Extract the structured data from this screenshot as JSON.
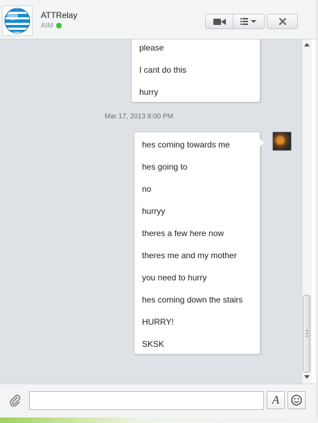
{
  "header": {
    "contact_name": "ATTRelay",
    "service": "AIM",
    "status_color": "#3cc43a",
    "avatar_icon": "att-globe-logo",
    "buttons": {
      "video_icon": "video-camera-icon",
      "menu_icon": "list-menu-icon",
      "close_icon": "close-icon"
    }
  },
  "conversation": {
    "incoming_messages": [
      "please",
      "I cant do this",
      "hurry"
    ],
    "timestamp": "Mar 17, 2013 8:00 PM",
    "outgoing_messages": [
      "hes coming towards me",
      "hes going to",
      "no",
      "hurryy",
      "theres a few here now",
      "theres me and my mother",
      "you need to hurry",
      "hes coming down the stairs",
      "HURRY!",
      "SKSK"
    ]
  },
  "footer": {
    "input_value": "",
    "attach_icon": "paperclip-icon",
    "font_button_label": "A",
    "emoji_icon": "smiley-icon"
  }
}
